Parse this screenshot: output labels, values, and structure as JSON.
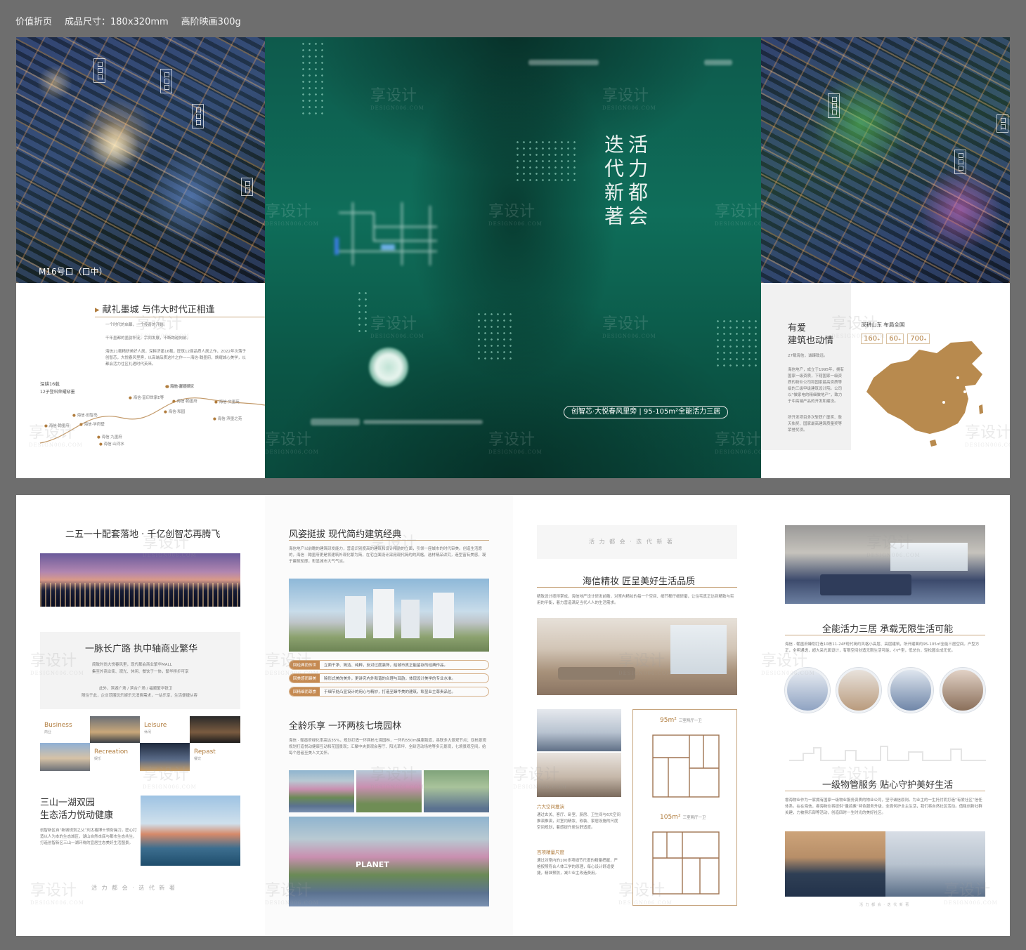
{
  "header": {
    "item1": "价值折页",
    "item2": "成品尺寸：180x320mm",
    "item3": "高阶映画300g"
  },
  "watermark": {
    "cn": "享设计",
    "en": "DESIGN006.COM"
  },
  "front": {
    "left": {
      "aerial_label": "M16号口（口中）",
      "title": "献礼墨城  与伟大时代正相逢",
      "p1": "一个时代的启幕，一个传奇的开始。",
      "p2": "千年墨都的墨韵积淀，宗同发展，不断跨越向前。",
      "p3": "海信21载精研美好人居，深耕济墨16载，匠筑12座品质人居之作，2022年次落子创智芯，大悦春风里旁，以高端品质这片之作——海信·翰墨府，焕耀城心美学，以都会活力住区礼遇时代英来。",
      "timeline_title": "深耕16载",
      "timeline_sub": "12子登科荣耀邸墨",
      "timeline": [
        "海信·翰墨府",
        "海信·创智岛",
        "海信·富印世家E等",
        "海信·富印世家",
        "海信·翰墨府",
        "海信·翰墨府",
        "海信·和园",
        "海信·文墨苑",
        "海信·学府墅",
        "海信·九墨府",
        "海信·山河水",
        "海信·滨墨之苑"
      ]
    },
    "cover": {
      "title_line1": "活力都会",
      "title_line2": "迭代新著",
      "tagline": "创智芯·大悦春风里旁 | 95-105m²全能活力三居"
    },
    "right": {
      "title_line1": "有爱",
      "title_line2": "建筑也动情",
      "sub": "深耕山东 布局全国",
      "stat1": "160",
      "stat2": "60",
      "stat3": "700",
      "p1": "27载海信，诚臻致远。",
      "p2": "海信地产，成立于1995年，拥有国家一级资质，下辖国家一级资质的物业公司和国家最高资质等级的三级甲级建筑设计院。公司以“做家电的精细做地产”，致力于中高端产品的开发和建设。",
      "p3": "所开发项目多次斩获广厦奖、詹天佑奖、国家最高建筑质量奖等荣誉奖项。"
    }
  },
  "inside": {
    "panel1": {
      "title": "二五一十配套落地 · 千亿创智芯再腾飞",
      "section2": "一脉长广路  执中轴商业繁华",
      "s2_p1": "简致时尚大悦春风里，现代都会商业繁华MALL",
      "s2_p2": "集至外商业街、观光、休闲、餐饮于一体，繁华移步可享",
      "s2_p3": "此外，滨湖广场 / 滨合广场 / 福顺繁华铁卫",
      "s2_p4": "随住于此，企业范围玩乐娱乐元消费需求，一站乐享，生活便捷从容",
      "biz": [
        {
          "en": "Business",
          "cn": "商业"
        },
        {
          "en": "Leisure",
          "cn": "休闲"
        },
        {
          "en": "Recreation",
          "cn": "娱乐"
        },
        {
          "en": "Repast",
          "cn": "餐饮"
        }
      ],
      "section3_line1": "三山一湖双园",
      "section3_line2": "生态活力悦动健康",
      "s3_p": "创智新区自“新城规划之父”刘太格博士领衔操刀，匠心打造以人为本的生态城区，湖山自然本底与都市生态共生，打造创智新区三山一湖环绕的宜居生态美好生活图景。",
      "footer": "活 力 都 会 · 迭 代 新 著"
    },
    "panel2": {
      "title": "风姿挺拔  现代简约建筑经典",
      "p": "海信地产以前瞻的建筑研发能力，营造识别度高的建筑和设计精韵的立面，引领一座城市的时代审美。创造生活愿的，海信 · 翰墨府更是将建筑外观化繁为简，在宅立面设计采用现代简约的风格，选材精品讲究，造型富有美感，凝于建筑轮廓，彰显城市大气气派。",
      "features": [
        {
          "tag": "回经典而传世",
          "text": "立面干净、简洁、纯粹，反对过度装饰，给城市真正能留存的经典作品。"
        },
        {
          "tag": "回美感而臻美",
          "text": "除形式美的美外，更讲究内外和谐的合理与耳韵，体现设计美学的专业水准。"
        },
        {
          "tag": "回精细而尊崇",
          "text": "于细节处凸显设计的用心与精妙，打造至臻华美的建筑，彰显业主尊贵品位。"
        }
      ],
      "section2": "全龄乐享  一环两核七境园林",
      "s2_p": "海信 · 翰墨府绿化率高达35%，规划打造一环两核七境园林，一环约550m健康跑道，串联多大景观节点；双核景观规划打造悦动健康互动和花园景观；汇聚中央景观会客厅、阳光草坪、全龄活动场地等多元景观，七境景观空间，给每个居者至美人文关怀。",
      "garden_sign": "PLANET"
    },
    "panel3": {
      "top": "活 力 都 会 · 迭 代 新 著",
      "title": "海信精妆  匠呈美好生活品质",
      "p": "精致设计揽得掌成，海信地产设计研发前瞻，对室内精妆的每一个空间、细节都仔细研磨，让住宅真正达到精致与实用的平衡，着力营造满足当代人人的生活需求。",
      "plan1_area": "95m²",
      "plan1_type": "三室两厅一卫",
      "plan2_area": "105m²",
      "plan2_type": "三室两厅一卫",
      "sub1": "六大空间推演",
      "sub1_p": "通过玄关、客厅、卧室、厨房、卫生间与6大空间推演推演，对室内精妆、软装、家居设施的尺度空间规划，着感提升居住舒适度。",
      "sub2": "百项精量尺度",
      "sub2_p": "通过对室内的100多项细节尺度的精量把握，严格按照符合人体工学的原理，每心设计舒适便捷，精准预防，减少业主改造费用。"
    },
    "panel4": {
      "title": "全能活力三居  承载无限生活可能",
      "p": "海信 · 翰墨府臻划打造10栋11-24F现代简约风格小高层、高层建筑，所开建面约95-105㎡全能三居空间。户型方正，全明通透，超大采光面设计，有限空间创造无限生活可能，小户型，低总价，轻松圆业成无忧。",
      "section2": "一级物管服务  贴心守护美好生活",
      "s2_p": "睿海物业作为一家拥有国家一级物业服务资质的物业公司，坚守诚信原则。为业主的一生托付而打造“有爱社区”信任体系。在在海信，睿海物业将提供“量鸽素”特色服务升级，全面何护业主生活，我们将自然社区活动。值租创新社群关建，力被俱乐部等活动，创造四时一生时光的美好社区。",
      "footer": "活 力 都 会 · 迭 代 新 著"
    }
  }
}
